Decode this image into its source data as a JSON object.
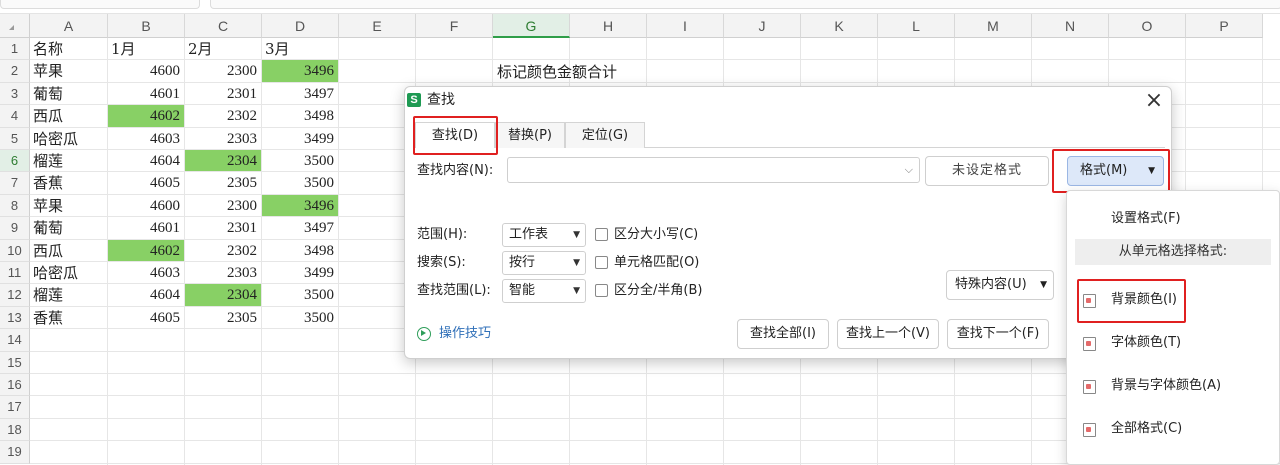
{
  "columns": [
    "A",
    "B",
    "C",
    "D",
    "E",
    "F",
    "G",
    "H",
    "I",
    "J",
    "K",
    "L",
    "M",
    "N",
    "O",
    "P"
  ],
  "rows": [
    "1",
    "2",
    "3",
    "4",
    "5",
    "6",
    "7",
    "8",
    "9",
    "10",
    "11",
    "12",
    "13",
    "14",
    "15",
    "16",
    "17",
    "18",
    "19"
  ],
  "header_row": [
    "名称",
    "1月",
    "2月",
    "3月"
  ],
  "data_rows": [
    {
      "name": "苹果",
      "jan": "4600",
      "feb": "2300",
      "mar": "3496"
    },
    {
      "name": "葡萄",
      "jan": "4601",
      "feb": "2301",
      "mar": "3497"
    },
    {
      "name": "西瓜",
      "jan": "4602",
      "feb": "2302",
      "mar": "3498"
    },
    {
      "name": "哈密瓜",
      "jan": "4603",
      "feb": "2303",
      "mar": "3499"
    },
    {
      "name": "榴莲",
      "jan": "4604",
      "feb": "2304",
      "mar": "3500"
    },
    {
      "name": "香蕉",
      "jan": "4605",
      "feb": "2305",
      "mar": "3500"
    },
    {
      "name": "苹果",
      "jan": "4600",
      "feb": "2300",
      "mar": "3496"
    },
    {
      "name": "葡萄",
      "jan": "4601",
      "feb": "2301",
      "mar": "3497"
    },
    {
      "name": "西瓜",
      "jan": "4602",
      "feb": "2302",
      "mar": "3498"
    },
    {
      "name": "哈密瓜",
      "jan": "4603",
      "feb": "2303",
      "mar": "3499"
    },
    {
      "name": "榴莲",
      "jan": "4604",
      "feb": "2304",
      "mar": "3500"
    },
    {
      "name": "香蕉",
      "jan": "4605",
      "feb": "2305",
      "mar": "3500"
    }
  ],
  "note": "标记颜色金额合计",
  "highlight_color": "#88d065",
  "selection_color": "#2e9e48",
  "dialog": {
    "icon": "S",
    "title": "查找",
    "close_icon": "×",
    "tabs": [
      "查找(D)",
      "替换(P)",
      "定位(G)"
    ],
    "find_label": "查找内容(N):",
    "find_value": "",
    "no_format_label": "未设定格式",
    "format_button": "格式(M)",
    "scope_label": "范围(H):",
    "scope_value": "工作表",
    "search_label": "搜索(S):",
    "search_value": "按行",
    "lookin_label": "查找范围(L):",
    "lookin_value": "智能",
    "option_match_case": "区分大小写(C)",
    "option_match_cell": "单元格匹配(O)",
    "option_match_width": "区分全/半角(B)",
    "special_button": "特殊内容(U)",
    "tips_link": "操作技巧",
    "find_all": "查找全部(I)",
    "find_prev": "查找上一个(V)",
    "find_next": "查找下一个(F)"
  },
  "format_menu": {
    "set_format": "设置格式(F)",
    "from_cell_header": "从单元格选择格式:",
    "bg_color": "背景颜色(I)",
    "font_color": "字体颜色(T)",
    "bg_and_font_color": "背景与字体颜色(A)",
    "all_formats": "全部格式(C)"
  },
  "annotation_color": "#e02020"
}
